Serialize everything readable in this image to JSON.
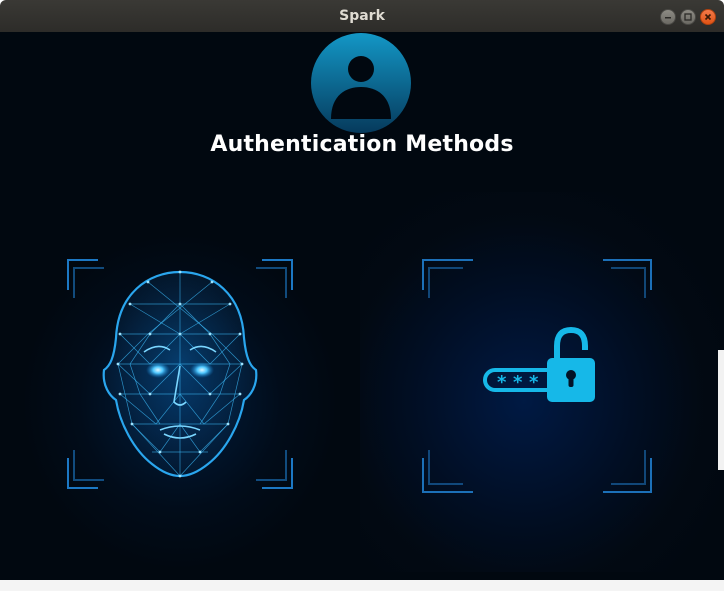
{
  "window": {
    "title": "Spark"
  },
  "main": {
    "heading": "Authentication Methods"
  },
  "methods": [
    {
      "name": "face-recognition",
      "icon": "face-scan-icon"
    },
    {
      "name": "password",
      "icon": "password-lock-icon"
    }
  ],
  "colors": {
    "background": "#010810",
    "accent": "#16b8e8",
    "titlebar": "#2d2c29",
    "close_button": "#e05315"
  }
}
